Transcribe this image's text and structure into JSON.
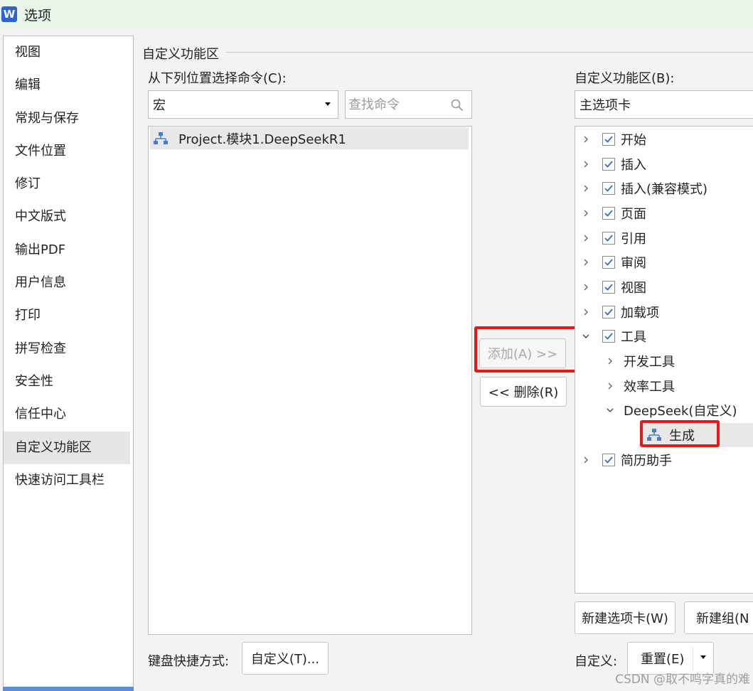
{
  "window": {
    "title": "选项",
    "logo_letter": "W"
  },
  "sidebar": {
    "items": [
      {
        "label": "视图"
      },
      {
        "label": "编辑"
      },
      {
        "label": "常规与保存"
      },
      {
        "label": "文件位置"
      },
      {
        "label": "修订"
      },
      {
        "label": "中文版式"
      },
      {
        "label": "输出PDF"
      },
      {
        "label": "用户信息"
      },
      {
        "label": "打印"
      },
      {
        "label": "拼写检查"
      },
      {
        "label": "安全性"
      },
      {
        "label": "信任中心"
      },
      {
        "label": "自定义功能区",
        "active": true
      },
      {
        "label": "快速访问工具栏"
      }
    ]
  },
  "main": {
    "group_title": "自定义功能区",
    "source": {
      "label": "从下列位置选择命令(C):",
      "combo_value": "宏",
      "search_placeholder": "查找命令",
      "commands": [
        {
          "label": "Project.模块1.DeepSeekR1",
          "icon": "macro-icon"
        }
      ]
    },
    "buttons": {
      "add": "添加(A) >>",
      "remove": "<< 删除(R)",
      "new_tab": "新建选项卡(W)",
      "new_group": "新建组(N",
      "keyboard_customize": "自定义(T)...",
      "reset": "重置(E)"
    },
    "target": {
      "label": "自定义功能区(B):",
      "combo_value": "主选项卡",
      "tree": [
        {
          "label": "开始",
          "checked": true,
          "expanded": false
        },
        {
          "label": "插入",
          "checked": true,
          "expanded": false
        },
        {
          "label": "插入(兼容模式)",
          "checked": true,
          "expanded": false
        },
        {
          "label": "页面",
          "checked": true,
          "expanded": false
        },
        {
          "label": "引用",
          "checked": true,
          "expanded": false
        },
        {
          "label": "审阅",
          "checked": true,
          "expanded": false
        },
        {
          "label": "视图",
          "checked": true,
          "expanded": false
        },
        {
          "label": "加载项",
          "checked": true,
          "expanded": false
        },
        {
          "label": "工具",
          "checked": true,
          "expanded": true
        },
        {
          "label": "开发工具",
          "level": 1,
          "expanded": false
        },
        {
          "label": "效率工具",
          "level": 1,
          "expanded": false
        },
        {
          "label": "DeepSeek(自定义)",
          "level": 1,
          "expanded": true
        },
        {
          "label": "生成",
          "level": 2,
          "icon": "macro-icon",
          "selected": true
        },
        {
          "label": "简历助手",
          "checked": true,
          "expanded": false
        }
      ]
    },
    "keyboard_label": "键盘快捷方式:",
    "customize_label": "自定义:"
  },
  "watermark": "CSDN @取不鸣字真的难",
  "colors": {
    "highlight_frame": "#e3191a",
    "logo": "#2b63d9",
    "checkbox_tick": "#2f6fd6",
    "macro_icon": "#4a7bd0"
  }
}
